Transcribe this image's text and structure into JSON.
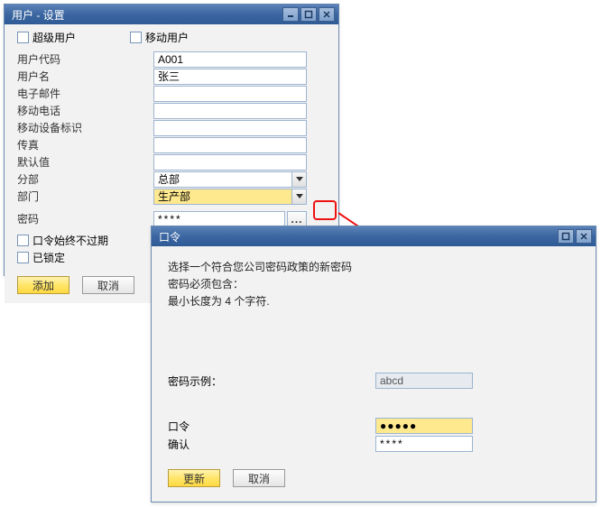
{
  "win1": {
    "title": "用户 - 设置",
    "checks": {
      "super": "超级用户",
      "mobile": "移动用户"
    },
    "labels": {
      "usercode": "用户代码",
      "username": "用户名",
      "email": "电子邮件",
      "mobilephone": "移动电话",
      "mobiledevice": "移动设备标识",
      "fax": "传真",
      "defaults": "默认值",
      "branch": "分部",
      "dept": "部门",
      "password": "密码",
      "noexpire": "口令始终不过期",
      "locked": "已锁定"
    },
    "values": {
      "usercode": "A001",
      "username": "张三",
      "branch": "总部",
      "dept": "生产部",
      "password": "****"
    },
    "buttons": {
      "add": "添加",
      "cancel": "取消",
      "ellipsis": "..."
    }
  },
  "win2": {
    "title": "口令",
    "info": {
      "l1": "选择一个符合您公司密码政策的新密码",
      "l2": "密码必须包含：",
      "l3": "最小长度为 4 个字符."
    },
    "labels": {
      "example": "密码示例：",
      "password": "口令",
      "confirm": "确认"
    },
    "values": {
      "example": "abcd",
      "password": "●●●●●",
      "confirm": "****"
    },
    "buttons": {
      "update": "更新",
      "cancel": "取消"
    }
  }
}
